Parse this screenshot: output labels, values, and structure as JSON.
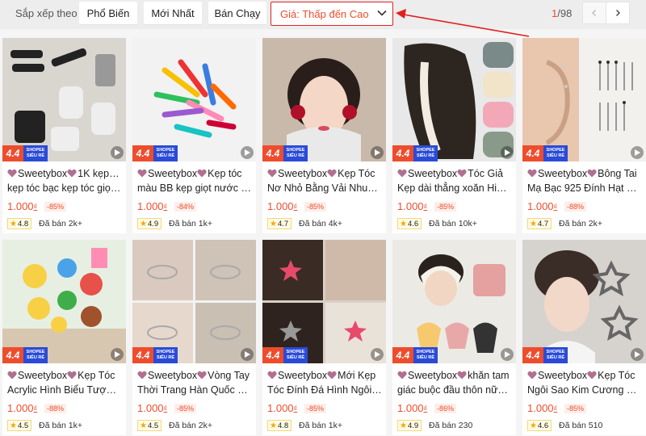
{
  "sort": {
    "label": "Sắp xếp theo",
    "options": [
      "Phổ Biến",
      "Mới Nhất",
      "Bán Chạy"
    ],
    "price_select": "Giá: Thấp đến Cao"
  },
  "pager": {
    "current": "1",
    "total": "/98"
  },
  "badge": {
    "event": "4.4",
    "line1": "SHOPEE",
    "line2": "SIÊU RẺ"
  },
  "accent": "#ee4d2d",
  "products": [
    {
      "line1": "Sweetybox",
      "line1b": "1K kẹp tóc",
      "line2": "kẹp tóc bạc kẹp tóc giọt…",
      "price": "1.000",
      "currency": "₫",
      "discount": "-85%",
      "rating": "4.8",
      "sold": "Đã bán 2k+"
    },
    {
      "line1": "Sweetybox",
      "line1b": "Kẹp tóc",
      "line2": "màu BB kẹp giọt nước d…",
      "price": "1.000",
      "currency": "₫",
      "discount": "-84%",
      "rating": "4.9",
      "sold": "Đã bán 1k+"
    },
    {
      "line1": "Sweetybox",
      "line1b": "Kẹp Tóc",
      "line2": "Nơ Nhỏ Bằng Vải Nhung…",
      "price": "1.000",
      "currency": "₫",
      "discount": "-85%",
      "rating": "4.7",
      "sold": "Đã bán 4k+"
    },
    {
      "line1": "Sweetybox",
      "line1b": "Tóc Giả",
      "line2": "Kẹp dài thẳng xoăn High…",
      "price": "1.000",
      "currency": "₫",
      "discount": "-85%",
      "rating": "4.6",
      "sold": "Đã bán 10k+"
    },
    {
      "line1": "Sweetybox",
      "line1b": "Bông Tai",
      "line2": "Mạ Bạc 925 Đính Hạt Ph…",
      "price": "1.000",
      "currency": "₫",
      "discount": "-88%",
      "rating": "4.7",
      "sold": "Đã bán 2k+"
    },
    {
      "line1": "Sweetybox",
      "line1b": "Kẹp Tóc",
      "line2": "Acrylic Hình Biểu Tượng…",
      "price": "1.000",
      "currency": "₫",
      "discount": "-88%",
      "rating": "4.5",
      "sold": "Đã bán 1k+"
    },
    {
      "line1": "Sweetybox",
      "line1b": "Vòng Tay",
      "line2": "Thời Trang Hàn Quốc Đơ…",
      "price": "1.000",
      "currency": "₫",
      "discount": "-85%",
      "rating": "4.5",
      "sold": "Đã bán 2k+"
    },
    {
      "line1": "Sweetybox",
      "line1b": "Mới Kẹp",
      "line2": "Tóc Đính Đá Hình Ngôi S…",
      "price": "1.000",
      "currency": "₫",
      "discount": "-85%",
      "rating": "4.8",
      "sold": "Đã bán 1k+"
    },
    {
      "line1": "Sweetybox",
      "line1b": "khăn tam",
      "line2": "giác buộc đầu thôn nữ…",
      "price": "1.000",
      "currency": "₫",
      "discount": "-86%",
      "rating": "4.9",
      "sold": "Đã bán 230"
    },
    {
      "line1": "Sweetybox",
      "line1b": "Kẹp Tóc",
      "line2": "Ngôi Sao Kim Cương Nữ…",
      "price": "1.000",
      "currency": "₫",
      "discount": "-85%",
      "rating": "4.6",
      "sold": "Đã bán 510"
    }
  ]
}
